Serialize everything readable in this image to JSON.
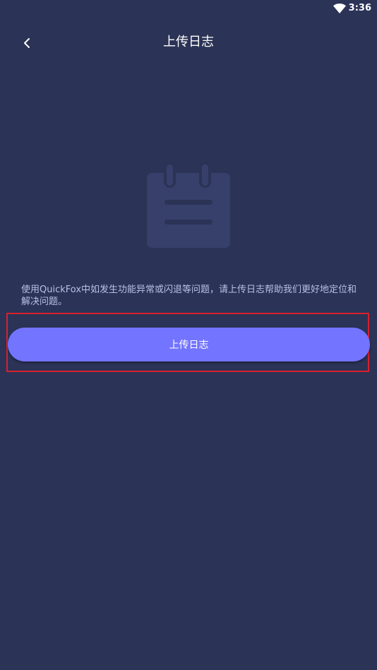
{
  "status_bar": {
    "time": "3:36",
    "wifi_icon": "wifi-icon"
  },
  "header": {
    "back_icon": "chevron-left-icon",
    "title": "上传日志"
  },
  "main": {
    "illustration_icon": "notepad-icon",
    "description": "使用QuickFox中如发生功能异常或闪退等问题，请上传日志帮助我们更好地定位和解决问题。",
    "upload_button_label": "上传日志"
  },
  "colors": {
    "background": "#2b3356",
    "accent": "#7374ff",
    "icon_fill": "#36406a",
    "description_text": "#b9c0e6",
    "highlight": "#d8202e"
  }
}
